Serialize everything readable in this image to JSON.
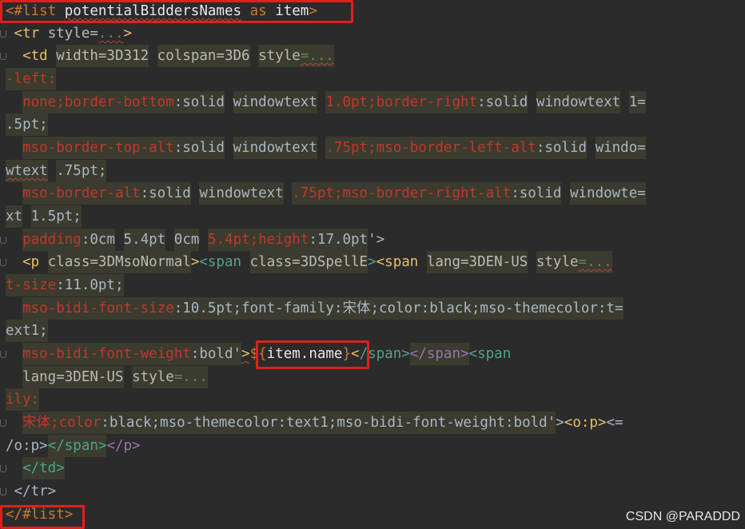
{
  "editor": {
    "lines": [
      {
        "segments": [
          {
            "text": "<#list ",
            "cls": "kw"
          },
          {
            "text": "potentialBiddersNames",
            "cls": "expr wavy"
          },
          {
            "text": " as ",
            "cls": "kw"
          },
          {
            "text": "item",
            "cls": "expr"
          },
          {
            "text": ">",
            "cls": "kw"
          }
        ]
      },
      {
        "segments": [
          {
            "text": " <tr ",
            "cls": "tag"
          },
          {
            "text": "style",
            "cls": "attr"
          },
          {
            "text": "=",
            "cls": "attr"
          },
          {
            "text": "...",
            "cls": "val wavy"
          },
          {
            "text": ">",
            "cls": "tag"
          }
        ]
      },
      {
        "segments": [
          {
            "text": "  <td ",
            "cls": "tag"
          },
          {
            "text": "width=3D312",
            "cls": "attr hl"
          },
          {
            "text": " ",
            "cls": ""
          },
          {
            "text": "colspan=3D6",
            "cls": "attr hl"
          },
          {
            "text": " ",
            "cls": ""
          },
          {
            "text": "style",
            "cls": "attr hl"
          },
          {
            "text": "=...",
            "cls": "val hl wavy"
          }
        ]
      },
      {
        "segments": [
          {
            "text": "-left:",
            "cls": "red hl"
          }
        ]
      },
      {
        "segments": [
          {
            "text": "  ",
            "cls": ""
          },
          {
            "text": "none;border-bottom",
            "cls": "red hl"
          },
          {
            "text": ":solid",
            "cls": "cssval hl"
          },
          {
            "text": " ",
            "cls": ""
          },
          {
            "text": "windowtext",
            "cls": "cssval hl"
          },
          {
            "text": " ",
            "cls": ""
          },
          {
            "text": "1.0pt;border-right",
            "cls": "red hl"
          },
          {
            "text": ":solid",
            "cls": "cssval hl"
          },
          {
            "text": " ",
            "cls": ""
          },
          {
            "text": "windowtext",
            "cls": "cssval hl"
          },
          {
            "text": " ",
            "cls": ""
          },
          {
            "text": "1=",
            "cls": "cssval hl"
          }
        ]
      },
      {
        "segments": [
          {
            "text": ".5pt;",
            "cls": "cssval hl"
          }
        ]
      },
      {
        "segments": [
          {
            "text": "  ",
            "cls": ""
          },
          {
            "text": "mso-border-top-alt",
            "cls": "red hl"
          },
          {
            "text": ":solid",
            "cls": "cssval hl"
          },
          {
            "text": " ",
            "cls": ""
          },
          {
            "text": "windowtext",
            "cls": "cssval hl"
          },
          {
            "text": " ",
            "cls": ""
          },
          {
            "text": ".75pt;mso-border-left-alt",
            "cls": "red hl"
          },
          {
            "text": ":solid",
            "cls": "cssval hl"
          },
          {
            "text": " ",
            "cls": ""
          },
          {
            "text": "windo=",
            "cls": "cssval hl"
          }
        ]
      },
      {
        "segments": [
          {
            "text": "wtext",
            "cls": "cssval hl wavy"
          },
          {
            "text": " ",
            "cls": ""
          },
          {
            "text": ".75pt;",
            "cls": "cssval hl"
          }
        ]
      },
      {
        "segments": [
          {
            "text": "  ",
            "cls": ""
          },
          {
            "text": "mso-border-alt",
            "cls": "red hl"
          },
          {
            "text": ":solid",
            "cls": "cssval hl"
          },
          {
            "text": " ",
            "cls": ""
          },
          {
            "text": "windowtext",
            "cls": "cssval hl"
          },
          {
            "text": " ",
            "cls": ""
          },
          {
            "text": ".75pt;mso-border-right-alt",
            "cls": "red hl"
          },
          {
            "text": ":solid",
            "cls": "cssval hl"
          },
          {
            "text": " ",
            "cls": ""
          },
          {
            "text": "windowte=",
            "cls": "cssval hl"
          }
        ]
      },
      {
        "segments": [
          {
            "text": "xt",
            "cls": "cssval hl"
          },
          {
            "text": " ",
            "cls": ""
          },
          {
            "text": "1.5pt;",
            "cls": "cssval hl"
          }
        ]
      },
      {
        "segments": [
          {
            "text": "  ",
            "cls": ""
          },
          {
            "text": "padding",
            "cls": "red hl"
          },
          {
            "text": ":0cm",
            "cls": "cssval hl"
          },
          {
            "text": " ",
            "cls": ""
          },
          {
            "text": "5.4pt",
            "cls": "cssval hl"
          },
          {
            "text": " ",
            "cls": ""
          },
          {
            "text": "0cm",
            "cls": "cssval hl"
          },
          {
            "text": " ",
            "cls": ""
          },
          {
            "text": "5.4pt;height",
            "cls": "red hl"
          },
          {
            "text": ":17.0pt",
            "cls": "cssval hl"
          },
          {
            "text": "'>",
            "cls": "cssval"
          }
        ]
      },
      {
        "segments": [
          {
            "text": "  <p ",
            "cls": "tag"
          },
          {
            "text": "class=3DMsoNormal",
            "cls": "attr hl"
          },
          {
            "text": ">",
            "cls": "tag"
          },
          {
            "text": "<span ",
            "cls": "tagg"
          },
          {
            "text": "class=3DSpellE",
            "cls": "attr hl"
          },
          {
            "text": ">",
            "cls": "tagg"
          },
          {
            "text": "<span ",
            "cls": "tag"
          },
          {
            "text": "lang=3DEN-US",
            "cls": "attr hl"
          },
          {
            "text": " ",
            "cls": ""
          },
          {
            "text": "style",
            "cls": "attr hl"
          },
          {
            "text": "=...",
            "cls": "val hl wavy"
          }
        ]
      },
      {
        "segments": [
          {
            "text": "t-size",
            "cls": "red hl"
          },
          {
            "text": ":11.0pt;",
            "cls": "cssval hl"
          }
        ]
      },
      {
        "segments": [
          {
            "text": "  ",
            "cls": ""
          },
          {
            "text": "mso-bidi-font-size",
            "cls": "red hl"
          },
          {
            "text": ":10.5pt;font-family:宋体;color:black;mso-themecolor:t=",
            "cls": "cssval hl"
          }
        ]
      },
      {
        "segments": [
          {
            "text": "ext1;",
            "cls": "cssval hl"
          }
        ]
      },
      {
        "segments": [
          {
            "text": "  ",
            "cls": ""
          },
          {
            "text": "mso-bidi-font-weight",
            "cls": "red hl"
          },
          {
            "text": ":bold'",
            "cls": "cssval hl"
          },
          {
            "text": ">",
            "cls": "tag wavy"
          },
          {
            "text": "${",
            "cls": "dollar"
          },
          {
            "text": "item.name",
            "cls": "expr"
          },
          {
            "text": "}",
            "cls": "dollar"
          },
          {
            "text": "<",
            "cls": "tag"
          },
          {
            "text": "/span>",
            "cls": "tagg"
          },
          {
            "text": "</span>",
            "cls": "tagd hl"
          },
          {
            "text": "<span",
            "cls": "tagg"
          }
        ]
      },
      {
        "segments": [
          {
            "text": "  ",
            "cls": ""
          },
          {
            "text": "lang=3DEN-US",
            "cls": "attr hl"
          },
          {
            "text": " ",
            "cls": ""
          },
          {
            "text": "style",
            "cls": "attr hl"
          },
          {
            "text": "=...",
            "cls": "val hl"
          }
        ]
      },
      {
        "segments": [
          {
            "text": "ily:",
            "cls": "red hl"
          }
        ]
      },
      {
        "segments": [
          {
            "text": "  ",
            "cls": ""
          },
          {
            "text": "宋体;color",
            "cls": "red hl"
          },
          {
            "text": ":black;mso-themecolor:text1;mso-bidi-font-weight:bold'",
            "cls": "cssval hl"
          },
          {
            "text": ">",
            "cls": "cssval"
          },
          {
            "text": "<o:p>",
            "cls": "tag"
          },
          {
            "text": "<=",
            "cls": "cssval"
          }
        ]
      },
      {
        "segments": [
          {
            "text": "/o:p>",
            "cls": "cssval"
          },
          {
            "text": "</span>",
            "cls": "tagg hl"
          },
          {
            "text": "</p>",
            "cls": "tagd"
          }
        ]
      },
      {
        "segments": [
          {
            "text": "  ",
            "cls": ""
          },
          {
            "text": "</td>",
            "cls": "tagg hl"
          }
        ]
      },
      {
        "segments": [
          {
            "text": " </tr>",
            "cls": "cssval"
          }
        ]
      },
      {
        "segments": [
          {
            "text": "</#list>",
            "cls": "kw"
          }
        ]
      }
    ]
  },
  "watermark": "CSDN @PARADDD",
  "colors": {
    "background": "#2b2b2b",
    "highlight_box": "#e0201b"
  }
}
